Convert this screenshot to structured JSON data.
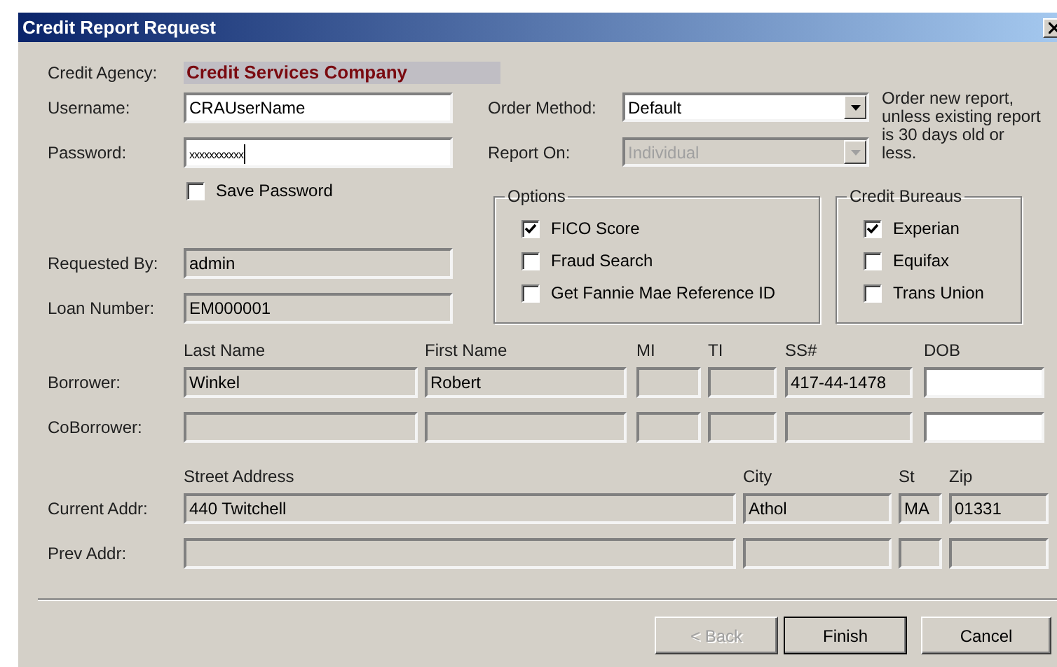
{
  "window": {
    "title": "Credit Report Request"
  },
  "credit_agency": {
    "label": "Credit Agency:",
    "value": "Credit Services Company"
  },
  "username": {
    "label": "Username:",
    "value": "CRAUserName"
  },
  "password": {
    "label": "Password:",
    "value": "xxxxxxxxxxx"
  },
  "save_password": {
    "label": "Save Password",
    "checked": false
  },
  "order_method": {
    "label": "Order Method:",
    "value": "Default",
    "disabled": false
  },
  "report_on": {
    "label": "Report On:",
    "value": "Individual",
    "disabled": true
  },
  "order_note": "Order new report, unless existing report is 30 days old or less.",
  "options": {
    "title": "Options",
    "items": [
      {
        "label": "FICO Score",
        "checked": true
      },
      {
        "label": "Fraud Search",
        "checked": false
      },
      {
        "label": "Get Fannie Mae Reference ID",
        "checked": false
      }
    ]
  },
  "credit_bureaus": {
    "title": "Credit Bureaus",
    "items": [
      {
        "label": "Experian",
        "checked": true
      },
      {
        "label": "Equifax",
        "checked": false
      },
      {
        "label": "Trans Union",
        "checked": false
      }
    ]
  },
  "requested_by": {
    "label": "Requested By:",
    "value": "admin"
  },
  "loan_number": {
    "label": "Loan Number:",
    "value": "EM000001"
  },
  "name_columns": [
    "Last Name",
    "First Name",
    "MI",
    "TI",
    "SS#",
    "DOB"
  ],
  "name_rows": [
    {
      "label": "Borrower:",
      "fields": [
        {
          "value": "Winkel",
          "editable": false
        },
        {
          "value": "Robert",
          "editable": false
        },
        {
          "editable": false
        },
        {
          "editable": false
        },
        {
          "value": "417-44-1478",
          "editable": false
        },
        {
          "editable": true
        }
      ]
    },
    {
      "label": "CoBorrower:",
      "fields": [
        {
          "editable": false
        },
        {
          "editable": false
        },
        {
          "editable": false
        },
        {
          "editable": false
        },
        {
          "editable": false
        },
        {
          "editable": true
        }
      ]
    }
  ],
  "address_columns": [
    "Street Address",
    "City",
    "St",
    "Zip"
  ],
  "address_rows": [
    {
      "label": "Current Addr:",
      "fields": [
        {
          "value": "440 Twitchell",
          "editable": false
        },
        {
          "value": "Athol",
          "editable": false
        },
        {
          "value": "MA",
          "editable": false
        },
        {
          "value": "01331",
          "editable": false
        }
      ]
    },
    {
      "label": "Prev Addr:",
      "fields": [
        {
          "editable": false
        },
        {
          "editable": false
        },
        {
          "editable": false
        },
        {
          "editable": false
        }
      ]
    }
  ],
  "buttons": [
    {
      "label": "< Back",
      "disabled": true,
      "default": false
    },
    {
      "label": "Finish",
      "disabled": false,
      "default": true
    },
    {
      "label": "Cancel",
      "disabled": false,
      "default": false
    }
  ]
}
